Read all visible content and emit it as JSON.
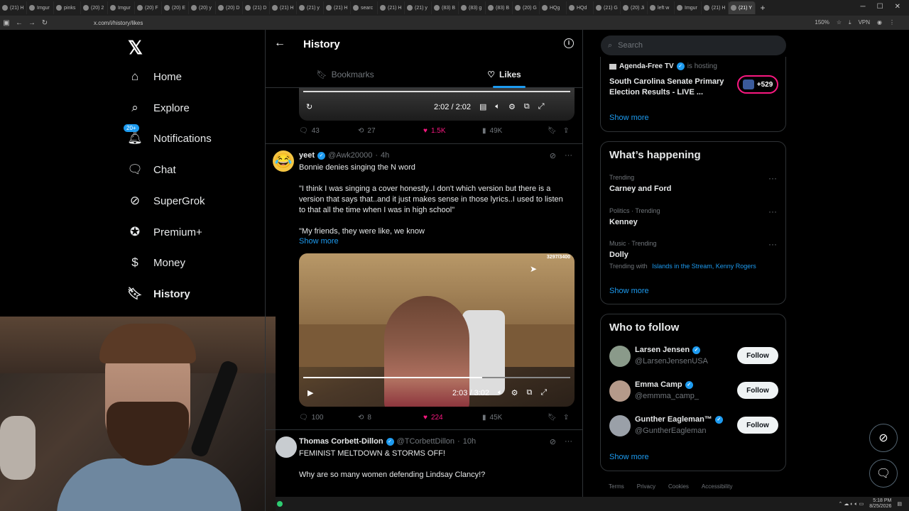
{
  "browser": {
    "tabs": [
      "(21) H",
      "Imgur",
      "pinks",
      "(20) 2",
      "Imgur",
      "(20) F",
      "(20) E",
      "(20) y",
      "(20) D",
      "(21) D",
      "(21) H",
      "(21) y",
      "(21) H",
      "searc",
      "(21) H",
      "(21) y",
      "(83) B",
      "(83) g",
      "(83) B",
      "(20) G",
      "HQg",
      "HQd",
      "(21) G",
      "(20) Ji",
      "left w",
      "Imgur",
      "(21) H",
      "(21) Y"
    ],
    "url": "x.com/i/history/likes",
    "zoom": "150%",
    "vpn": "VPN"
  },
  "left_nav": {
    "items": [
      {
        "label": "Home",
        "icon": "home-icon"
      },
      {
        "label": "Explore",
        "icon": "search-icon"
      },
      {
        "label": "Notifications",
        "icon": "bell-icon",
        "badge": "20+"
      },
      {
        "label": "Chat",
        "icon": "chat-icon"
      },
      {
        "label": "SuperGrok",
        "icon": "grok-icon"
      },
      {
        "label": "Premium+",
        "icon": "premium-icon"
      },
      {
        "label": "Money",
        "icon": "money-icon"
      },
      {
        "label": "History",
        "icon": "history-icon",
        "active": true
      }
    ]
  },
  "header": {
    "title": "History",
    "tabs": [
      {
        "label": "Bookmarks",
        "active": false
      },
      {
        "label": "Likes",
        "active": true
      }
    ]
  },
  "post1": {
    "video_time": "2:02 / 2:02",
    "replies": "43",
    "reposts": "27",
    "likes": "1.5K",
    "views": "49K"
  },
  "post2": {
    "name": "yeet",
    "handle": "@Awk20000",
    "time": "4h",
    "text1": "Bonnie denies singing the N word",
    "text2": "\"I think I was singing a cover honestly..I don't which version but there is a version that says that..and it just makes sense in those lyrics..I used to listen to that all the time when I was in high school\"",
    "text3": "\"My friends, they were like, we know",
    "show_more": "Show more",
    "video_counter": "3297/3400",
    "video_time": "2:03 / 3:02",
    "replies": "100",
    "reposts": "8",
    "likes": "224",
    "views": "45K"
  },
  "post3": {
    "name": "Thomas Corbett-Dillon",
    "handle": "@TCorbettDillon",
    "time": "10h",
    "text1": "FEMINIST MELTDOWN & STORMS OFF!",
    "text2": "Why are so many women defending Lindsay Clancy!?"
  },
  "search": {
    "placeholder": "Search"
  },
  "live": {
    "host": "Agenda-Free TV",
    "is_hosting": "is hosting",
    "title": "South Carolina Senate Primary Election Results - LIVE ...",
    "count": "+529",
    "show_more": "Show more"
  },
  "whats_happening": {
    "title": "What’s happening",
    "trends": [
      {
        "meta": "Trending",
        "name": "Carney and Ford"
      },
      {
        "meta": "Politics · Trending",
        "name": "Kenney"
      },
      {
        "meta": "Music · Trending",
        "name": "Dolly",
        "with_label": "Trending with",
        "with_links": "Islands in the Stream, Kenny Rogers"
      }
    ],
    "show_more": "Show more"
  },
  "who_to_follow": {
    "title": "Who to follow",
    "people": [
      {
        "name": "Larsen Jensen",
        "handle": "@LarsenJensenUSA",
        "button": "Follow"
      },
      {
        "name": "Emma Camp",
        "handle": "@emmma_camp_",
        "button": "Follow"
      },
      {
        "name": "Gunther Eagleman™",
        "handle": "@GuntherEagleman",
        "button": "Follow"
      }
    ],
    "show_more": "Show more"
  },
  "footer": [
    "Terms",
    "Privacy",
    "Cookies",
    "Accessibility"
  ],
  "taskbar": {
    "time": "5:18 PM",
    "date": "8/25/2026"
  }
}
